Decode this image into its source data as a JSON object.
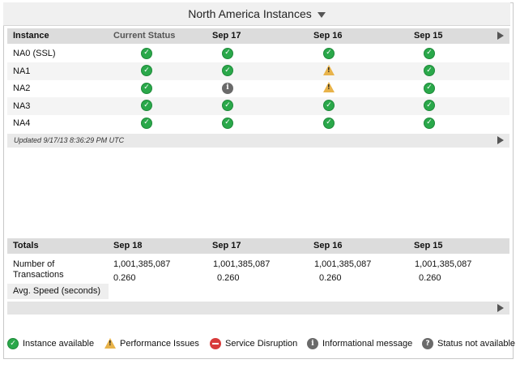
{
  "region": {
    "title": "North America Instances"
  },
  "status_table": {
    "headers": [
      "Instance",
      "Current Status",
      "Sep 17",
      "Sep 16",
      "Sep 15"
    ],
    "rows": [
      {
        "name": "NA0 (SSL)",
        "statuses": [
          "ok",
          "ok",
          "ok",
          "ok"
        ]
      },
      {
        "name": "NA1",
        "statuses": [
          "ok",
          "ok",
          "warn",
          "ok"
        ]
      },
      {
        "name": "NA2",
        "statuses": [
          "ok",
          "info",
          "warn",
          "ok"
        ]
      },
      {
        "name": "NA3",
        "statuses": [
          "ok",
          "ok",
          "ok",
          "ok"
        ]
      },
      {
        "name": "NA4",
        "statuses": [
          "ok",
          "ok",
          "ok",
          "ok"
        ]
      }
    ],
    "updated": "Updated 9/17/13 8:36:29 PM UTC"
  },
  "totals_table": {
    "headers": [
      "Totals",
      "Sep 18",
      "Sep 17",
      "Sep 16",
      "Sep 15"
    ],
    "transactions_label": "Number of Transactions",
    "transactions": [
      "1,001,385,087",
      "1,001,385,087",
      "1,001,385,087",
      "1,001,385,087"
    ],
    "speed_values": [
      "0.260",
      "0.260",
      "0.260",
      "0.260"
    ],
    "avg_speed_label": "Avg. Speed (seconds)"
  },
  "legend": {
    "available": "Instance available",
    "performance": "Performance Issues",
    "disruption": "Service Disruption",
    "informational": "Informational message",
    "not_available": "Status not available"
  },
  "icons": {
    "ok": "check-circle-icon",
    "warn": "warning-triangle-icon",
    "info": "info-circle-icon",
    "err": "minus-circle-icon",
    "help": "question-circle-icon"
  },
  "colors": {
    "ok": "#2aa84a",
    "warn": "#e8b34a",
    "err": "#d83b3b",
    "info": "#6a6a6a"
  }
}
